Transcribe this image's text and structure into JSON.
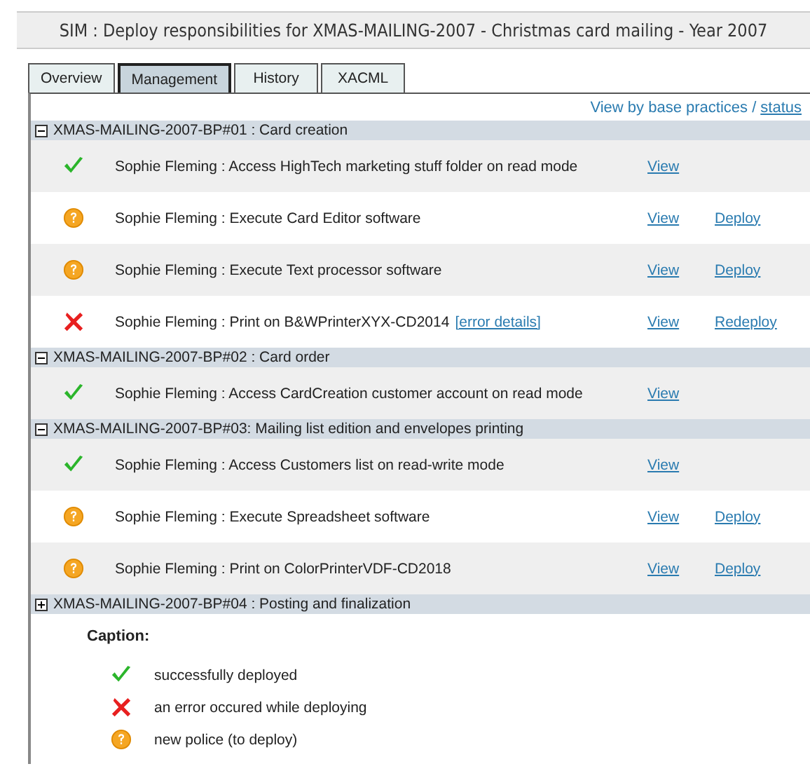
{
  "title": "SIM : Deploy responsibilities for XMAS-MAILING-2007 - Christmas card mailing - Year 2007",
  "tabs": [
    {
      "label": "Overview",
      "selected": false
    },
    {
      "label": "Management",
      "selected": true
    },
    {
      "label": "History",
      "selected": false
    },
    {
      "label": "XACML",
      "selected": false
    }
  ],
  "view_by": {
    "text": "View by base practices /",
    "link": "status"
  },
  "groups": [
    {
      "title": "XMAS-MAILING-2007-BP#01 : Card creation",
      "expanded": true,
      "rows": [
        {
          "kind": "ok",
          "text": "Sophie Fleming : Access HighTech marketing stuff folder on read mode",
          "view": "View"
        },
        {
          "kind": "pending",
          "text": "Sophie Fleming : Execute Card Editor software",
          "view": "View",
          "action": "Deploy"
        },
        {
          "kind": "pending",
          "text": "Sophie Fleming : Execute Text processor software",
          "view": "View",
          "action": "Deploy"
        },
        {
          "kind": "error",
          "text": "Sophie Fleming : Print on B&WPrinterXYX-CD2014",
          "error_link": "[error details]",
          "view": "View",
          "action": "Redeploy"
        }
      ]
    },
    {
      "title": "XMAS-MAILING-2007-BP#02 : Card order",
      "expanded": true,
      "rows": [
        {
          "kind": "ok",
          "text": "Sophie Fleming : Access CardCreation customer account on read mode",
          "view": "View"
        }
      ]
    },
    {
      "title": "XMAS-MAILING-2007-BP#03: Mailing list edition and envelopes printing",
      "expanded": true,
      "rows": [
        {
          "kind": "ok",
          "text": "Sophie Fleming : Access Customers list on read-write mode",
          "view": "View"
        },
        {
          "kind": "pending",
          "text": "Sophie Fleming : Execute Spreadsheet software",
          "view": "View",
          "action": "Deploy"
        },
        {
          "kind": "pending",
          "text": "Sophie Fleming : Print on ColorPrinterVDF-CD2018",
          "view": "View",
          "action": "Deploy"
        }
      ]
    },
    {
      "title": "XMAS-MAILING-2007-BP#04 : Posting and finalization",
      "expanded": false
    }
  ],
  "caption": {
    "title": "Caption:",
    "items": [
      {
        "kind": "ok",
        "text": "successfully deployed"
      },
      {
        "kind": "error",
        "text": "an error occured while deploying"
      },
      {
        "kind": "pending",
        "text": "new police (to deploy)"
      }
    ]
  }
}
